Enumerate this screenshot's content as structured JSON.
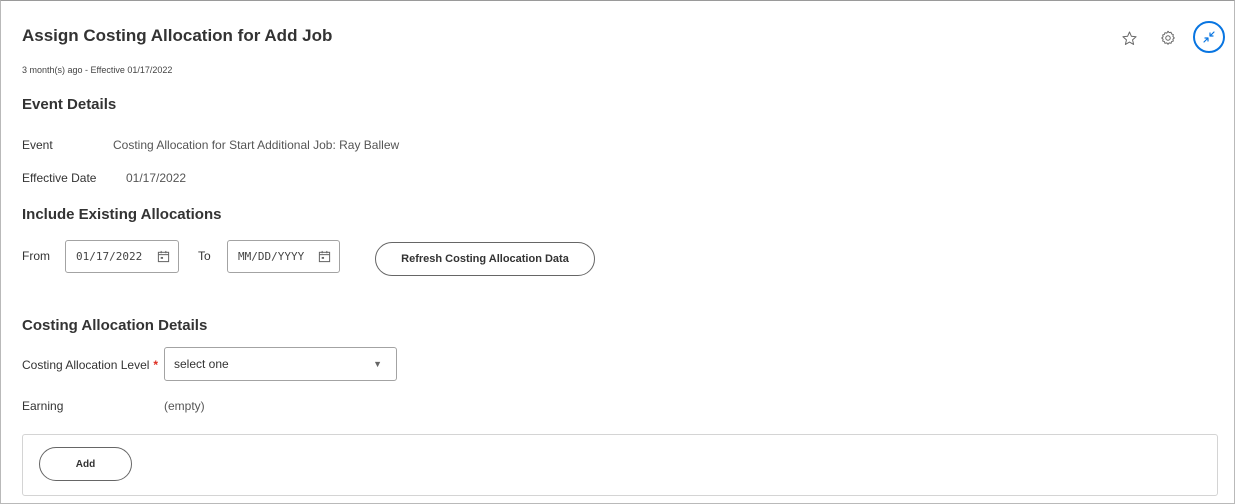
{
  "header": {
    "title": "Assign Costing Allocation for Add Job",
    "subtitle": "3 month(s) ago - Effective 01/17/2022"
  },
  "icons": {
    "favorite": "star-outline-icon",
    "settings": "gear-icon",
    "collapse": "collapse-arrows-icon"
  },
  "event_details": {
    "heading": "Event Details",
    "event_label": "Event",
    "event_value": "Costing Allocation for Start Additional Job: Ray Ballew",
    "effective_date_label": "Effective Date",
    "effective_date_value": "01/17/2022"
  },
  "include_existing": {
    "heading": "Include Existing Allocations",
    "from_label": "From",
    "from_value": "01/17/2022",
    "to_label": "To",
    "to_placeholder": "MM/DD/YYYY",
    "refresh_button": "Refresh Costing Allocation Data"
  },
  "costing_details": {
    "heading": "Costing Allocation Details",
    "level_label": "Costing Allocation Level",
    "required_mark": "*",
    "level_select_value": "select one",
    "earning_label": "Earning",
    "earning_value": "(empty)",
    "add_button": "Add"
  },
  "colors": {
    "accent": "#0875e1",
    "required": "#de2e21"
  }
}
